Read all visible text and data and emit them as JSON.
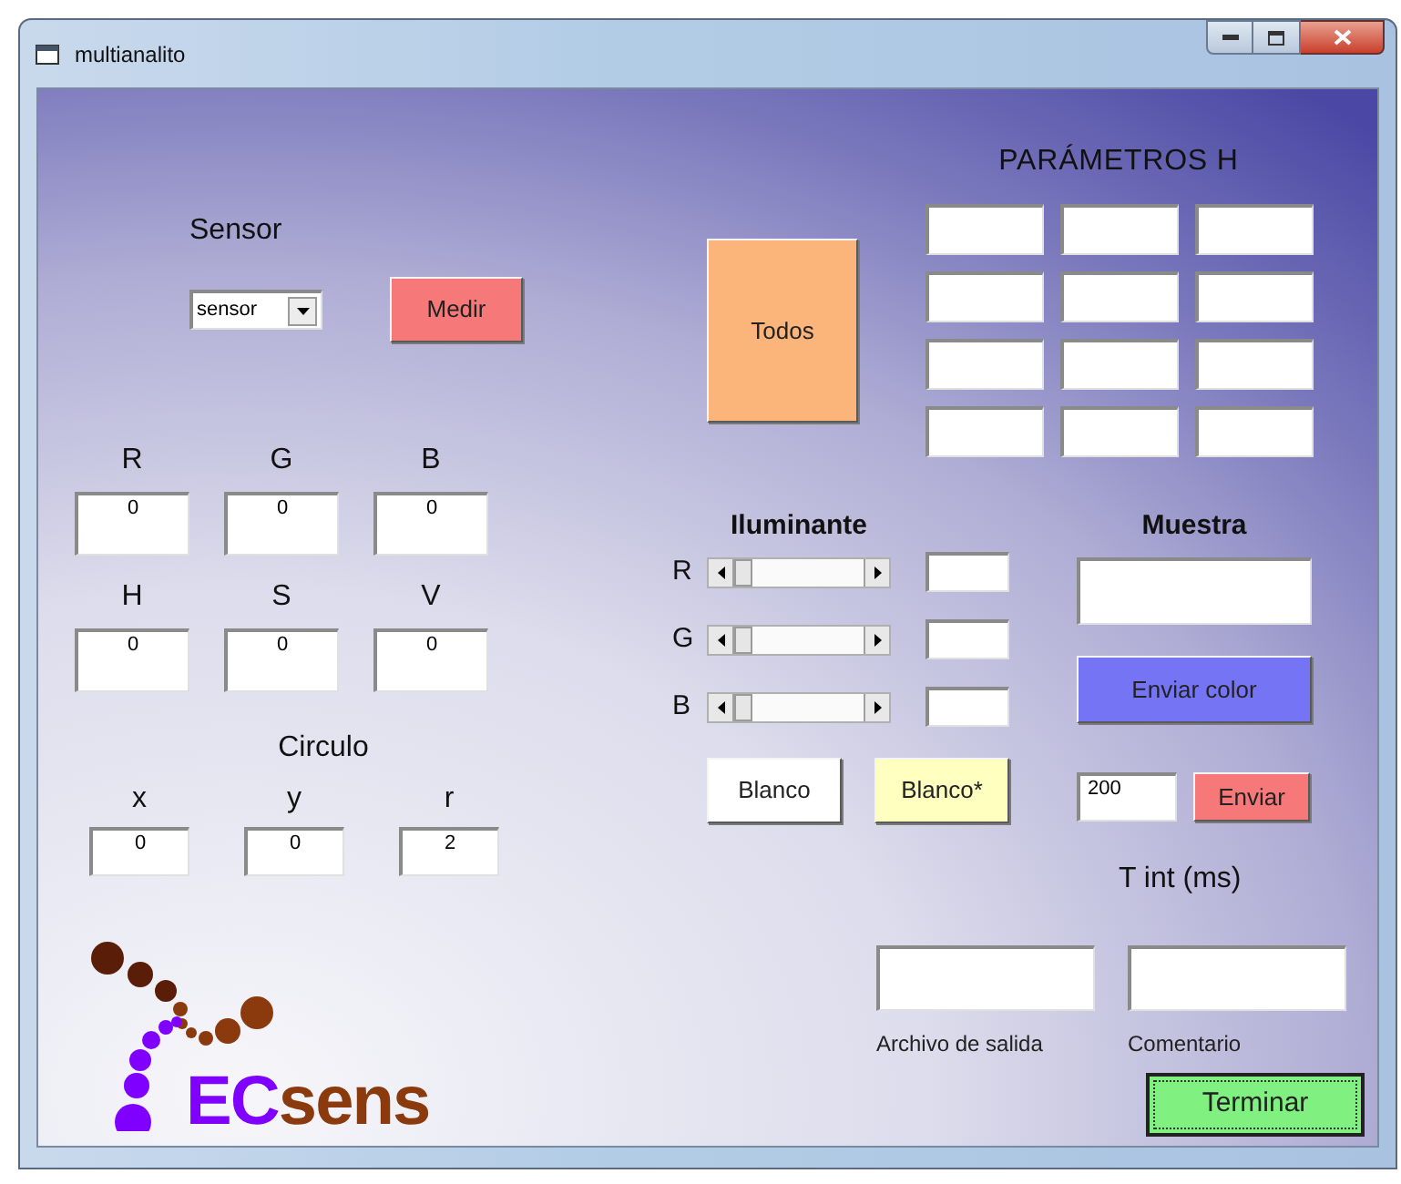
{
  "window": {
    "title": "multianalito"
  },
  "sensor": {
    "label": "Sensor",
    "dropdown": {
      "value": "sensor"
    },
    "button": "Medir"
  },
  "rgb": [
    {
      "label": "R",
      "value": "0"
    },
    {
      "label": "G",
      "value": "0"
    },
    {
      "label": "B",
      "value": "0"
    }
  ],
  "hsv": [
    {
      "label": "H",
      "value": "0"
    },
    {
      "label": "S",
      "value": "0"
    },
    {
      "label": "V",
      "value": "0"
    }
  ],
  "circle": {
    "title": "Circulo",
    "fields": [
      {
        "label": "x",
        "value": "0"
      },
      {
        "label": "y",
        "value": "0"
      },
      {
        "label": "r",
        "value": "2"
      }
    ]
  },
  "logo": {
    "parts": [
      "EC",
      "sens"
    ]
  },
  "parameters": {
    "title": "PARÁMETROS H",
    "button": "Todos"
  },
  "illuminant": {
    "title": "Iluminante",
    "channels": [
      {
        "label": "R"
      },
      {
        "label": "G"
      },
      {
        "label": "B"
      }
    ],
    "buttons": [
      {
        "label": "Blanco",
        "color": "#ffffff"
      },
      {
        "label": "Blanco*",
        "color": "#ffffc0"
      }
    ]
  },
  "sample": {
    "title": "Muestra",
    "button": "Enviar color"
  },
  "integration": {
    "value": "200",
    "button": "Enviar",
    "label": "T int (ms)"
  },
  "output": {
    "fields": [
      {
        "label": "Archivo de salida"
      },
      {
        "label": "Comentario"
      }
    ],
    "button": "Terminar"
  }
}
